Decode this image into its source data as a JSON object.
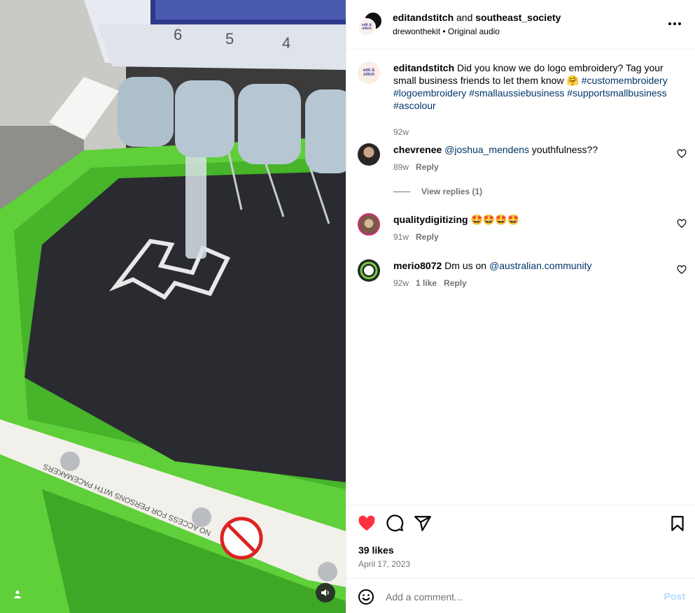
{
  "media": {
    "hoop_numbers": [
      "6",
      "5",
      "4"
    ],
    "warning_text": "NO ACCESS FOR PERSONS WITH PACEMAKERS",
    "icons": {
      "tag": "person-tag-icon",
      "sound": "speaker-icon"
    }
  },
  "header": {
    "account": "editandstitch",
    "connector": " and ",
    "collaborator": "southeast_society",
    "audio_author": "drewonthekit",
    "audio_sep": " • ",
    "audio_label": "Original audio",
    "avatar_text": "edit & stitch",
    "icons": {
      "more": "more-options-icon"
    }
  },
  "caption": {
    "username": "editandstitch",
    "text": "Did you know we do logo embroidery? Tag your small business friends to let them know 🤗",
    "hashtags": [
      "#customembroidery",
      "#logoembroidery",
      "#smallaussiebusiness",
      "#supportsmallbusiness",
      "#ascolour"
    ],
    "age": "92w"
  },
  "comments": [
    {
      "username": "chevrenee",
      "mention": "@joshua_mendens",
      "text": " youthfulness??",
      "age": "89w",
      "likes": "",
      "reply": "Reply",
      "view_replies": "View replies (1)"
    },
    {
      "username": "qualitydigitizing",
      "mention": "",
      "text": "🤩🤩🤩🤩",
      "age": "91w",
      "likes": "",
      "reply": "Reply"
    },
    {
      "username": "merio8072",
      "mention": "@australian.community",
      "text": "Dm us on ",
      "age": "92w",
      "likes": "1 like",
      "reply": "Reply"
    }
  ],
  "actions": {
    "likes": "39 likes",
    "date": "April 17, 2023",
    "liked": true,
    "like_color": "#ff3040",
    "icons": [
      "heart-icon",
      "comment-icon",
      "share-icon",
      "bookmark-icon"
    ]
  },
  "add_comment": {
    "placeholder": "Add a comment...",
    "post_label": "Post"
  },
  "colors": {
    "link": "#00376b",
    "muted": "#737373",
    "post_disabled": "#b3dbff",
    "hoop_green": "#5fcf3a"
  }
}
